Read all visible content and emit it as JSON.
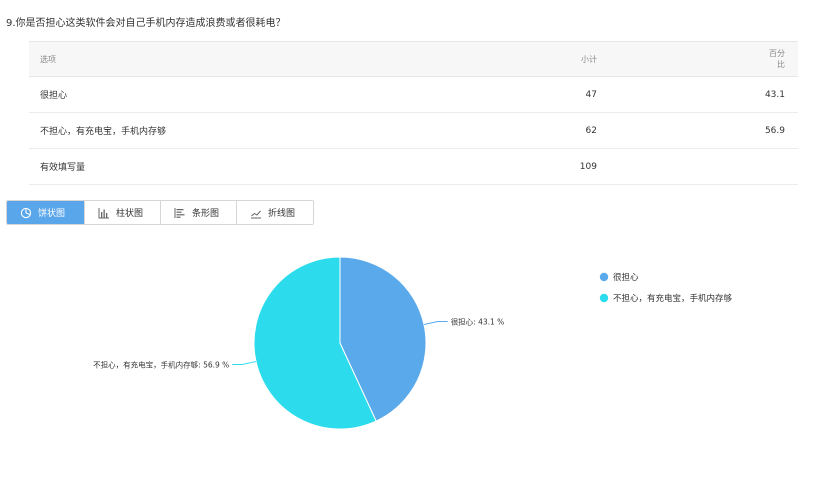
{
  "question": "9.你是否担心这类软件会对自己手机内存造成浪费或者很耗电？",
  "table": {
    "headers": {
      "option": "选项",
      "count": "小计",
      "percent": "百分比"
    },
    "rows": [
      {
        "option": "很担心",
        "count": "47",
        "percent": "43.1"
      },
      {
        "option": "不担心，有充电宝，手机内存够",
        "count": "62",
        "percent": "56.9"
      }
    ],
    "footer": {
      "label": "有效填写量",
      "count": "109"
    }
  },
  "tabs": [
    {
      "label": "饼状图",
      "icon": "pie-chart-icon",
      "active": true
    },
    {
      "label": "柱状图",
      "icon": "column-chart-icon",
      "active": false
    },
    {
      "label": "条形图",
      "icon": "bar-chart-icon",
      "active": false
    },
    {
      "label": "折线图",
      "icon": "line-chart-icon",
      "active": false
    }
  ],
  "chart_data": {
    "type": "pie",
    "slices": [
      {
        "label": "很担心",
        "value": 43.1,
        "data_label": "很担心: 43.1 %",
        "color": "#5aa9ea"
      },
      {
        "label": "不担心，有充电宝，手机内存够",
        "value": 56.9,
        "data_label": "不担心，有充电宝，手机内存够: 56.9 %",
        "color": "#2ddcec"
      }
    ],
    "legend": [
      "很担心",
      "不担心，有充电宝，手机内存够"
    ],
    "legend_position": "right",
    "start_angle": "top",
    "direction": "clockwise"
  }
}
